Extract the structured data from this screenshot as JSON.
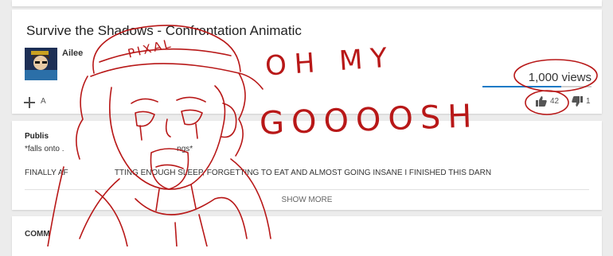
{
  "video": {
    "title": "Survive the Shadows - Confrontation Animatic",
    "channel": "Ailee",
    "views": "1,000 views",
    "view_bar_fraction": 0.72,
    "add_label": "A",
    "likes": "42",
    "dislikes": "1"
  },
  "description": {
    "published": "Publis",
    "line1": "*falls onto .                                                   ngs*",
    "line2": "FINALLY AF                     TTING ENOUGH SLEEP, FORGETTING TO EAT AND ALMOST GOING INSANE I FINISHED THIS DARN",
    "show_more": "SHOW MORE"
  },
  "comments": {
    "label": "COMM"
  },
  "overlay": {
    "text1": "OH MY",
    "text2": "GOOOOSH",
    "cap_text": "PIXAL"
  },
  "colors": {
    "accent_blue": "#167ac6",
    "ink_red": "#b81818"
  }
}
